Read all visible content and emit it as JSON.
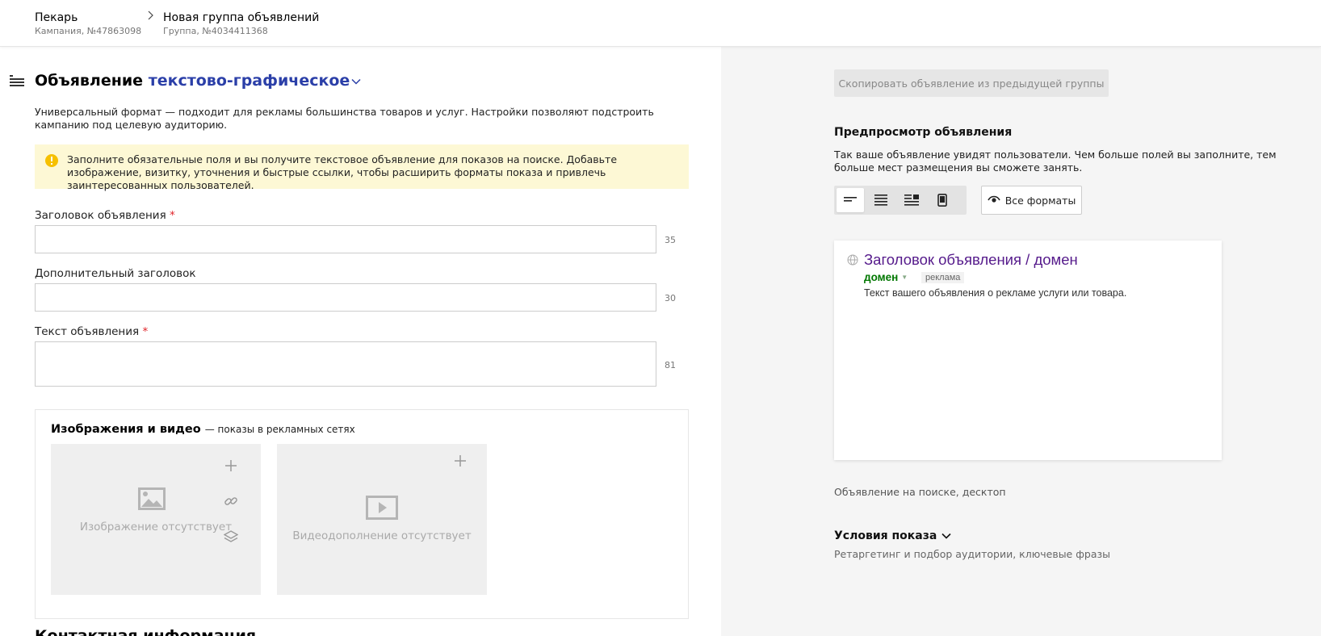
{
  "breadcrumbs": [
    {
      "title": "Пекарь",
      "subtitle": "Кампания, №47863098"
    },
    {
      "title": "Новая группа объявлений",
      "subtitle": "Группа, №4034411368"
    }
  ],
  "ad": {
    "title_prefix": "Объявление",
    "type": "текстово-графическое",
    "description": "Универсальный формат — подходит для рекламы большинства товаров и услуг. Настройки позволяют подстроить кампанию под целевую аудиторию.",
    "notice": "Заполните обязательные поля и вы получите текстовое объявление для показов на поиске. Добавьте изображение, визитку, уточнения и быстрые ссылки, чтобы расширить форматы показа и привлечь заинтересованных пользователей."
  },
  "fields": {
    "headline": {
      "label": "Заголовок объявления",
      "required_mark": "*",
      "value": "",
      "counter": "35"
    },
    "extra_headline": {
      "label": "Дополнительный заголовок",
      "value": "",
      "counter": "30"
    },
    "text": {
      "label": "Текст объявления",
      "required_mark": "*",
      "value": "",
      "counter": "81"
    }
  },
  "media": {
    "title": "Изображения и видео",
    "subtitle": "— показы в рекламных сетях",
    "image_placeholder": "Изображение отсутствует",
    "video_placeholder": "Видеодополнение отсутствует"
  },
  "next_section_heading": "Контактная информация",
  "preview": {
    "copy_button": "Скопировать объявление из предыдущей группы",
    "title": "Предпросмотр объявления",
    "description": "Так ваше объявление увидят пользователи. Чем больше полей вы заполните, тем больше мест размещения вы сможете занять.",
    "all_formats_button": "Все форматы",
    "card": {
      "title": "Заголовок объявления / домен",
      "domain": "домен",
      "ad_label": "реклама",
      "text": "Текст вашего объявления о рекламе услуги или товара."
    },
    "caption": "Объявление на поиске, десктоп"
  },
  "conditions": {
    "title": "Условия показа",
    "subtitle": "Ретаргетинг и подбор аудитории, ключевые фразы"
  },
  "colors": {
    "accent_link": "#2b3fa8",
    "notice_bg": "#fdf8d5",
    "required": "#e0242a",
    "preview_title": "#551a8b",
    "preview_domain": "#007700"
  }
}
